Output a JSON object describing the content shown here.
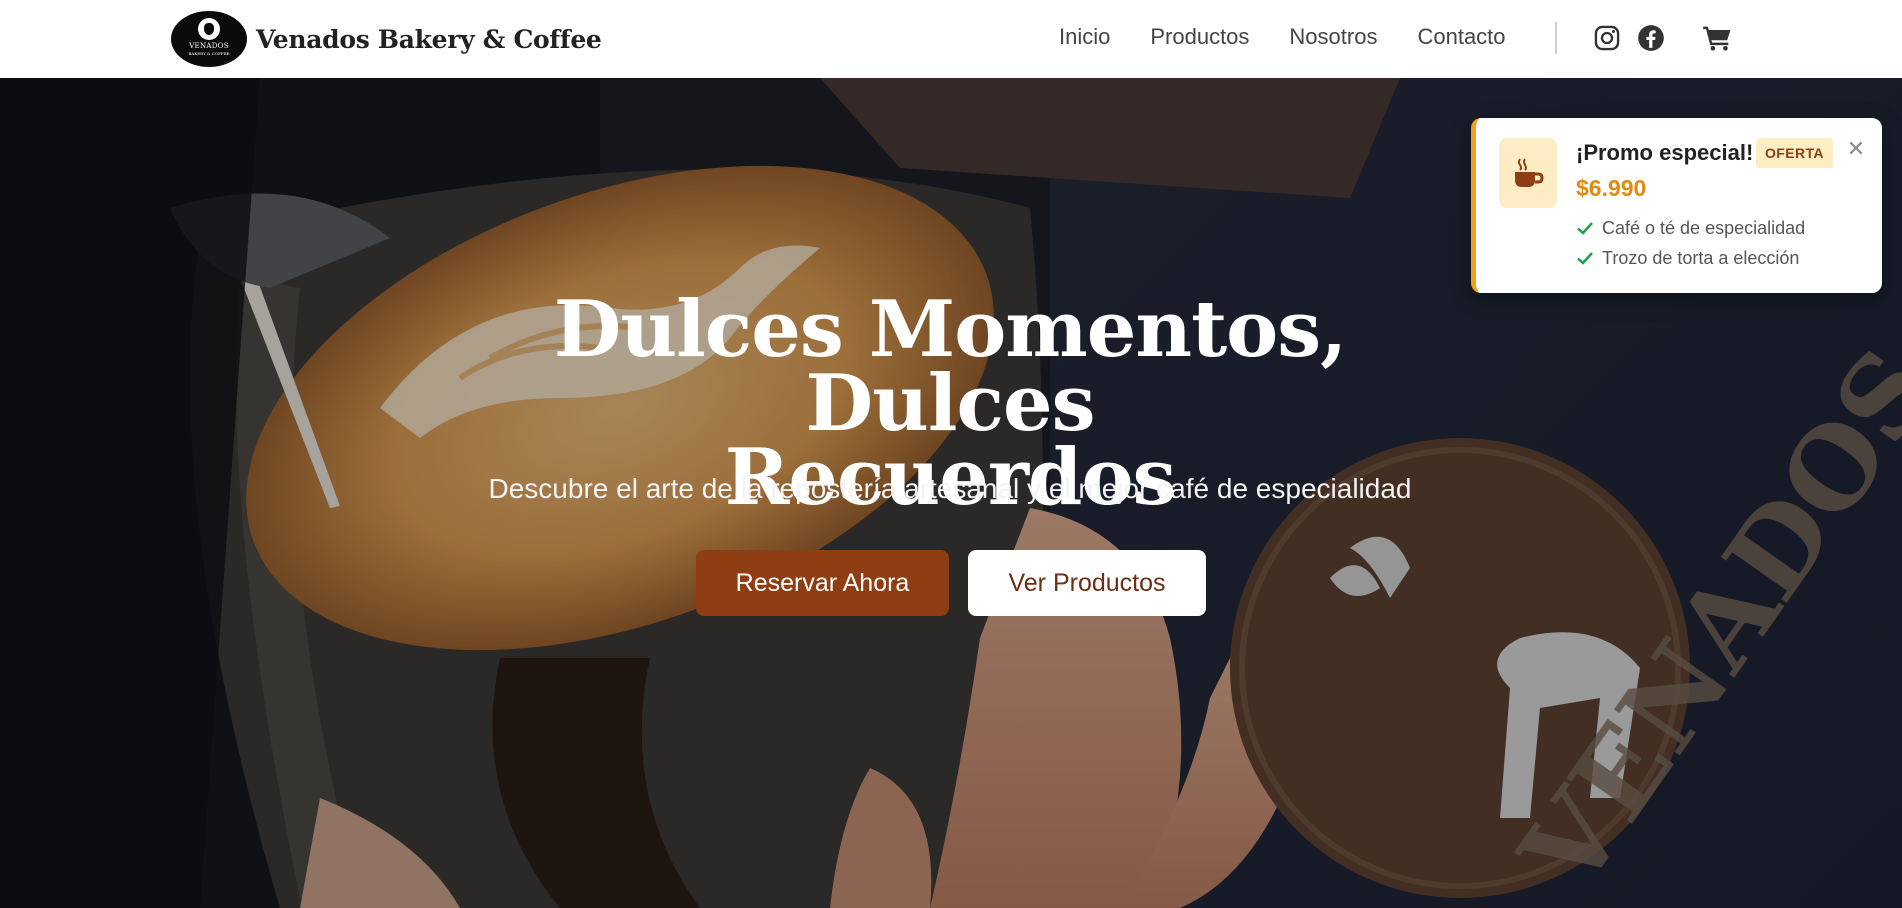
{
  "brand": {
    "name": "Venados Bakery & Coffee",
    "logo_text": "VENADOS",
    "logo_sub": "BAKERY & COFFEE"
  },
  "nav": {
    "links": [
      "Inicio",
      "Productos",
      "Nosotros",
      "Contacto"
    ],
    "icons": [
      "instagram-icon",
      "facebook-icon",
      "cart-icon"
    ]
  },
  "hero": {
    "title_line1": "Dulces Momentos, Dulces",
    "title_line2": "Recuerdos",
    "subtitle": "Descubre el arte de la repostería artesanal y el mejor café de especialidad",
    "primary_button": "Reservar Ahora",
    "secondary_button": "Ver Productos",
    "background_text": "VENADOS COFFEE"
  },
  "promo": {
    "title": "¡Promo especial!",
    "badge": "OFERTA",
    "price": "$6.990",
    "items": [
      "Café o té de especialidad",
      "Trozo de torta a elección"
    ],
    "close_symbol": "✕",
    "icon": "coffee-cup-icon"
  },
  "colors": {
    "primary": "#8f3d13",
    "accent": "#f2a01a",
    "price": "#e08a12",
    "check": "#16a34a"
  }
}
